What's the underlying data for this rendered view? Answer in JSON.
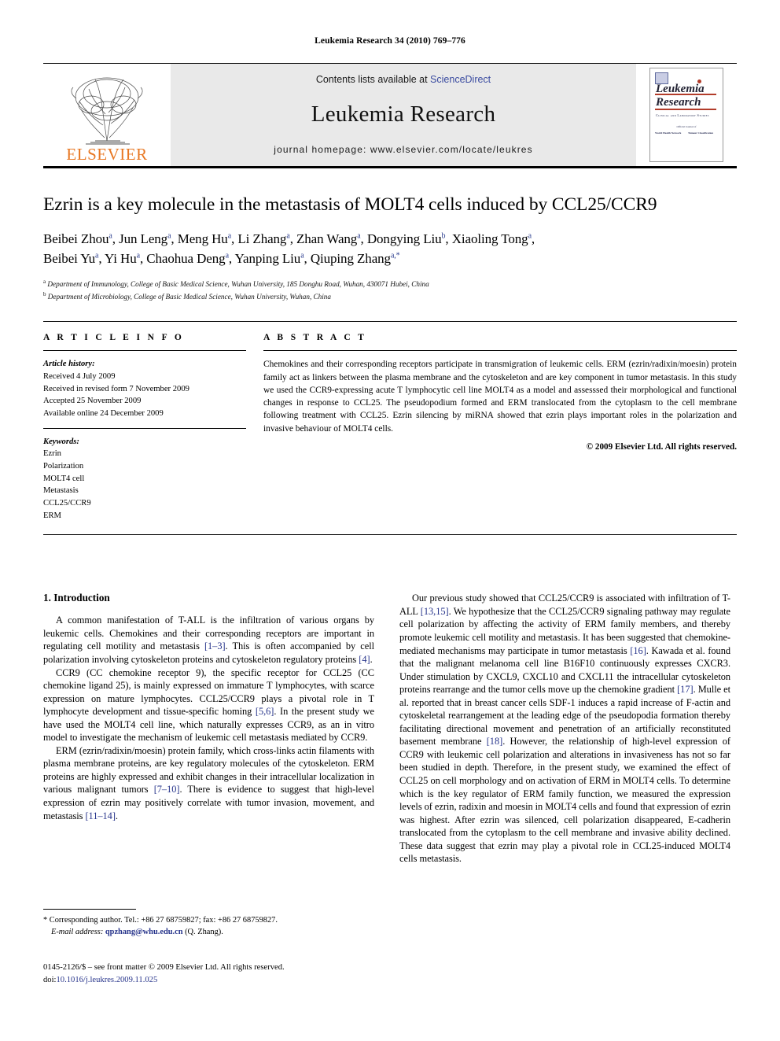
{
  "running_head": "Leukemia Research 34 (2010) 769–776",
  "masthead": {
    "publisher_name": "ELSEVIER",
    "contents_prefix": "Contents lists available at ",
    "sciencedirect": "ScienceDirect",
    "journal_name": "Leukemia Research",
    "homepage_prefix": "journal homepage: ",
    "homepage_url": "www.elsevier.com/locate/leukres",
    "cover": {
      "title_line1": "Leukemia",
      "title_line2": "Research",
      "subtitle": "Clinical and Laboratory Studies",
      "mini_line1": "Official Journal of",
      "mini_left": "World Health Network",
      "mini_right": "Tumour Classification"
    }
  },
  "article": {
    "title": "Ezrin is a key molecule in the metastasis of MOLT4 cells induced by CCL25/CCR9",
    "authors_line1": "Beibei Zhou<sup>a</sup>, Jun Leng<sup>a</sup>, Meng Hu<sup>a</sup>, Li Zhang<sup>a</sup>, Zhan Wang<sup>a</sup>, Dongying Liu<sup>b</sup>, Xiaoling Tong<sup>a</sup>,",
    "authors_line2": "Beibei Yu<sup>a</sup>, Yi Hu<sup>a</sup>, Chaohua Deng<sup>a</sup>, Yanping Liu<sup>a</sup>, Qiuping Zhang<sup>a,*</sup>",
    "affiliation_a": "<sup>a</sup> Department of Immunology, College of Basic Medical Science, Wuhan University, 185 Donghu Road, Wuhan, 430071 Hubei, China",
    "affiliation_b": "<sup>b</sup> Department of Microbiology, College of Basic Medical Science, Wuhan University, Wuhan, China"
  },
  "article_info": {
    "heading": "A R T I C L E    I N F O",
    "history_label": "Article history:",
    "history": [
      "Received 4 July 2009",
      "Received in revised form 7 November 2009",
      "Accepted 25 November 2009",
      "Available online 24 December 2009"
    ],
    "keywords_label": "Keywords:",
    "keywords": [
      "Ezrin",
      "Polarization",
      "MOLT4 cell",
      "Metastasis",
      "CCL25/CCR9",
      "ERM"
    ]
  },
  "abstract": {
    "heading": "A B S T R A C T",
    "text": "Chemokines and their corresponding receptors participate in transmigration of leukemic cells. ERM (ezrin/radixin/moesin) protein family act as linkers between the plasma membrane and the cytoskeleton and are key component in tumor metastasis. In this study we used the CCR9-expressing acute T lymphocytic cell line MOLT4 as a model and assesssed their morphological and functional changes in response to CCL25. The pseudopodium formed and ERM translocated from the cytoplasm to the cell membrane following treatment with CCL25. Ezrin silencing by miRNA showed that ezrin plays important roles in the polarization and invasive behaviour of MOLT4 cells.",
    "copyright": "© 2009 Elsevier Ltd. All rights reserved."
  },
  "body": {
    "section_number_title": "1.  Introduction",
    "left_paragraphs": [
      "A common manifestation of T-ALL is the infiltration of various organs by leukemic cells. Chemokines and their corresponding receptors are important in regulating cell motility and metastasis <span class=\"ref\">[1–3]</span>. This is often accompanied by cell polarization involving cytoskeleton proteins and cytoskeleton regulatory proteins <span class=\"ref\">[4]</span>.",
      "CCR9 (CC chemokine receptor 9), the specific receptor for CCL25 (CC chemokine ligand 25), is mainly expressed on immature T lymphocytes, with scarce expression on mature lymphocytes. CCL25/CCR9 plays a pivotal role in T lymphocyte development and tissue-specific homing <span class=\"ref\">[5,6]</span>. In the present study we have used the MOLT4 cell line, which naturally expresses CCR9, as an in vitro model to investigate the mechanism of leukemic cell metastasis mediated by CCR9.",
      "ERM (ezrin/radixin/moesin) protein family, which cross-links actin filaments with plasma membrane proteins, are key regulatory molecules of the cytoskeleton. ERM proteins are highly expressed and exhibit changes in their intracellular localization in various malignant tumors <span class=\"ref\">[7–10]</span>. There is evidence to suggest that high-level expression of ezrin may positively correlate with tumor invasion, movement, and metastasis <span class=\"ref\">[11–14]</span>."
    ],
    "right_paragraphs": [
      "Our previous study showed that CCL25/CCR9 is associated with infiltration of T-ALL <span class=\"ref\">[13,15]</span>. We hypothesize that the CCL25/CCR9 signaling pathway may regulate cell polarization by affecting the activity of ERM family members, and thereby promote leukemic cell motility and metastasis. It has been suggested that chemokine-mediated mechanisms may participate in tumor metastasis <span class=\"ref\">[16]</span>. Kawada et al. found that the malignant melanoma cell line B16F10 continuously expresses CXCR3. Under stimulation by CXCL9, CXCL10 and CXCL11 the intracellular cytoskeleton proteins rearrange and the tumor cells move up the chemokine gradient <span class=\"ref\">[17]</span>. Mulle et al. reported that in breast cancer cells SDF-1 induces a rapid increase of F-actin and cytoskeletal rearrangement at the leading edge of the pseudopodia formation thereby facilitating directional movement and penetration of an artificially reconstituted basement membrane <span class=\"ref\">[18]</span>. However, the relationship of high-level expression of CCR9 with leukemic cell polarization and alterations in invasiveness has not so far been studied in depth. Therefore, in the present study, we examined the effect of CCL25 on cell morphology and on activation of ERM in MOLT4 cells. To determine which is the key regulator of ERM family function, we measured the expression levels of ezrin, radixin and moesin in MOLT4 cells and found that expression of ezrin was highest. After ezrin was silenced, cell polarization disappeared, E-cadherin translocated from the cytoplasm to the cell membrane and invasive ability declined. These data suggest that ezrin may play a pivotal role in CCL25-induced MOLT4 cells metastasis."
    ]
  },
  "footnote": {
    "line1": "* Corresponding author. Tel.: +86 27 68759827; fax: +86 27 68759827.",
    "email_label": "E-mail address:",
    "email": "qpzhang@whu.edu.cn",
    "email_suffix": " (Q. Zhang)."
  },
  "footer": {
    "issn_line": "0145-2126/$ – see front matter © 2009 Elsevier Ltd. All rights reserved.",
    "doi_label": "doi:",
    "doi": "10.1016/j.leukres.2009.11.025"
  }
}
